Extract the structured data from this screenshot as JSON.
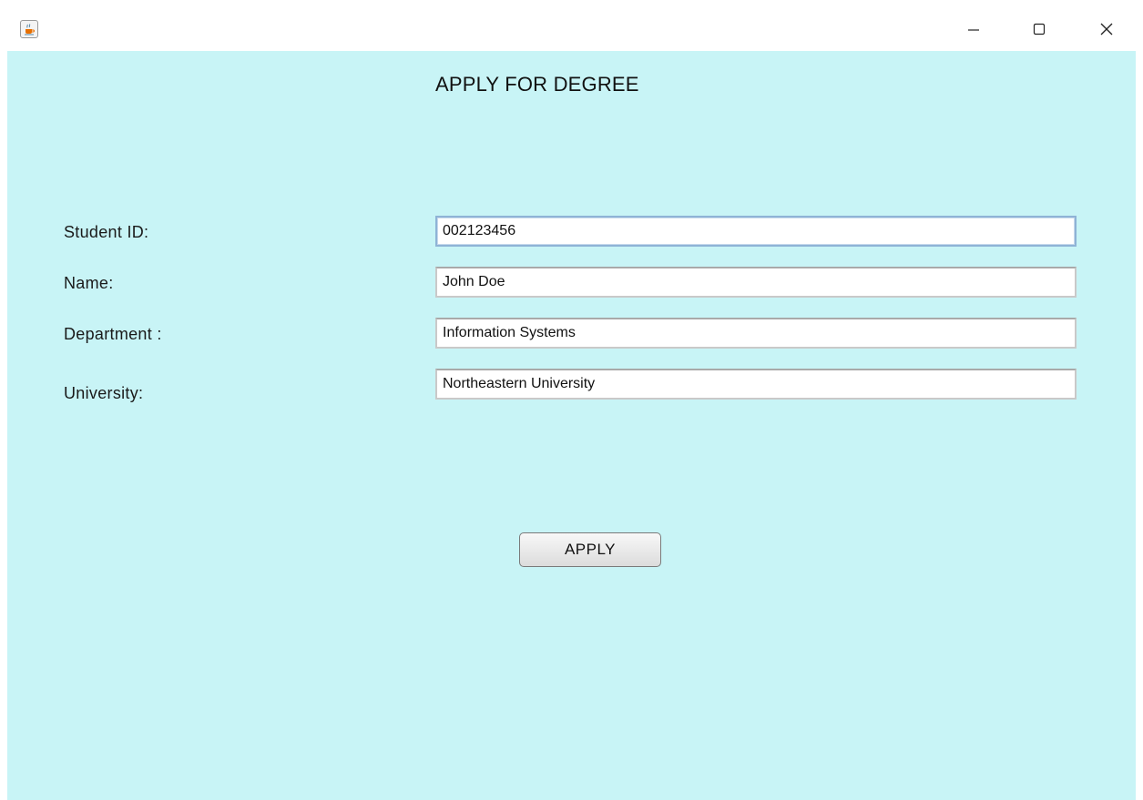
{
  "window": {
    "title": "",
    "icon": "java-cup-icon",
    "controls": {
      "minimize": "minimize-icon",
      "maximize": "maximize-icon",
      "close": "close-icon"
    }
  },
  "form": {
    "heading": "APPLY FOR DEGREE",
    "fields": [
      {
        "label": "Student ID:",
        "value": "002123456",
        "focused": true
      },
      {
        "label": "Name:",
        "value": "John Doe",
        "focused": false
      },
      {
        "label": "Department :",
        "value": "Information Systems",
        "focused": false
      },
      {
        "label": "University:",
        "value": "Northeastern University",
        "focused": false
      }
    ],
    "apply_label": "APPLY"
  },
  "colors": {
    "background": "#c8f4f6",
    "focus_border": "#8fb3d6"
  }
}
